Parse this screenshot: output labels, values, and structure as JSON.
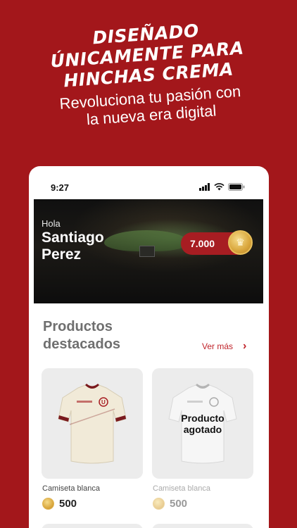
{
  "promo": {
    "headline_line1": "DISEÑADO",
    "headline_line2": "ÚNICAMENTE PARA",
    "headline_line3": "HINCHAS CREMA",
    "subline_1": "Revoluciona tu pasión con",
    "subline_2": "la nueva era digital"
  },
  "status_bar": {
    "time": "9:27",
    "icons": [
      "signal-icon",
      "wifi-icon",
      "battery-icon"
    ]
  },
  "banner": {
    "greeting": "Hola",
    "first_name": "Santiago",
    "last_name": "Perez",
    "points": "7.000",
    "points_icon": "crown-coin-icon"
  },
  "featured": {
    "title_line1": "Productos",
    "title_line2": "destacados",
    "see_more": "Ver más",
    "products": [
      {
        "name": "Camiseta blanca",
        "price": "500",
        "sold_out": false
      },
      {
        "name": "Camiseta blanca",
        "price": "500",
        "sold_out": true,
        "sold_out_line1": "Producto",
        "sold_out_line2": "agotado"
      }
    ]
  },
  "colors": {
    "brand_red": "#a3171b",
    "accent_red": "#c0232a",
    "gold": "#d9a63c"
  }
}
